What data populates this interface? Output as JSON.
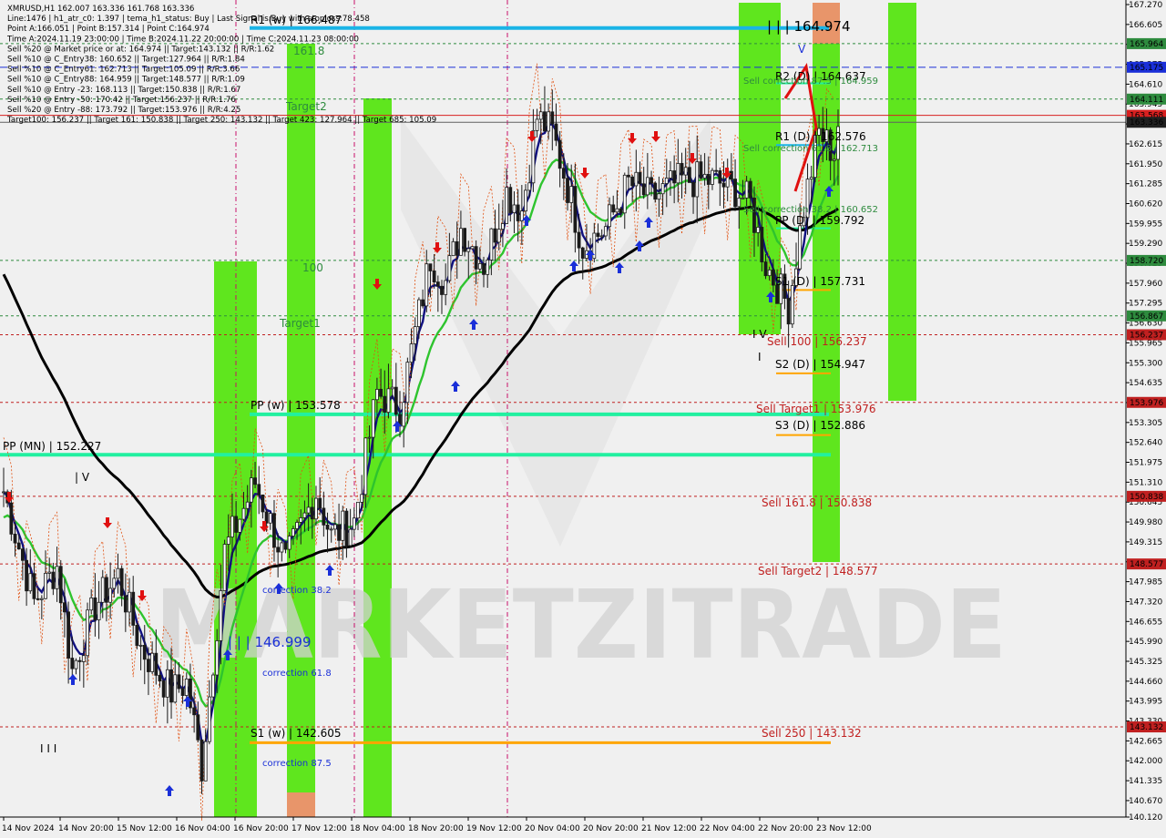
{
  "chart_data": {
    "type": "candlestick",
    "symbol": "XMRUSD",
    "timeframe": "H1",
    "ylim": [
      140.12,
      167.27
    ],
    "y_ticks": [
      "167.270",
      "166.605",
      "165.940",
      "165.275",
      "164.610",
      "163.945",
      "163.280",
      "162.615",
      "161.950",
      "161.285",
      "160.620",
      "159.955",
      "159.290",
      "158.625",
      "157.960",
      "157.295",
      "156.630",
      "155.965",
      "155.300",
      "154.635",
      "153.970",
      "153.305",
      "152.640",
      "151.975",
      "151.310",
      "150.645",
      "149.980",
      "149.315",
      "148.650",
      "147.985",
      "147.320",
      "146.655",
      "145.990",
      "145.325",
      "144.660",
      "143.995",
      "143.330",
      "142.665",
      "142.000",
      "141.335",
      "140.670",
      "140.120"
    ],
    "x_labels": [
      "14 Nov 2024",
      "14 Nov 20:00",
      "15 Nov 12:00",
      "16 Nov 04:00",
      "16 Nov 20:00",
      "17 Nov 12:00",
      "18 Nov 04:00",
      "18 Nov 20:00",
      "19 Nov 12:00",
      "20 Nov 04:00",
      "20 Nov 20:00",
      "21 Nov 12:00",
      "22 Nov 04:00",
      "22 Nov 20:00",
      "23 Nov 12:00"
    ],
    "info_lines": [
      "XMRUSD,H1  162.007 163.336 161.768 163.336",
      "Line:1476  |  h1_atr_c0: 1.397  |  tema_h1_status: Buy  |  Last Signal is:Buy with stoploss:78.458",
      "Point A:166.051  |  Point B:157.314  |  Point C:164.974",
      "Time A:2024.11.19 23:00:00  |  Time B:2024.11.22 20:00:00  |  Time C:2024.11.23 08:00:00",
      "Sell %20 @ Market price or at: 164.974  ||  Target:143.132  ||  R/R:1.62",
      "Sell %10 @ C_Entry38: 160.652  ||  Target:127.964  ||  R/R:1.84",
      "Sell %10 @ C_Entry61: 162.713  ||  Target:105.09  ||  R/R:3.66",
      "Sell %10 @ C_Entry88: 164.959  ||  Target:148.577  ||  R/R:1.09",
      "Sell %10 @ Entry -23: 168.113  ||  Target:150.838  ||  R/R:1.67",
      "Sell %10 @ Entry -50: 170.42  ||  Target:156.237  ||  R/R:1.76",
      "Sell %20 @ Entry -88: 173.792  ||  Target:153.976  ||  R/R:4.25",
      "Target100: 156.237  ||  Target 161: 150.838  ||  Target 250: 143.132  ||  Target 423: 127.964  ||  Target 685: 105.09"
    ],
    "price_tags": [
      {
        "text": "165.964",
        "color": "#2e8b3e"
      },
      {
        "text": "165.175",
        "color": "#1a2fd8"
      },
      {
        "text": "164.111",
        "color": "#2e8b3e"
      },
      {
        "text": "163.568",
        "color": "#d82020"
      },
      {
        "text": "163.336",
        "color": "#202020"
      },
      {
        "text": "158.720",
        "color": "#2e8b3e"
      },
      {
        "text": "156.867",
        "color": "#2e8b3e"
      },
      {
        "text": "156.237",
        "color": "#c02020"
      },
      {
        "text": "153.976",
        "color": "#c02020"
      },
      {
        "text": "150.838",
        "color": "#c02020"
      },
      {
        "text": "148.577",
        "color": "#c02020"
      },
      {
        "text": "143.132",
        "color": "#c02020"
      }
    ],
    "level_labels": [
      {
        "text": "R1 (w) | 166.487",
        "color": "#000000"
      },
      {
        "text": "| | | 164.974",
        "color": "#000000"
      },
      {
        "text": "R2 (D) | 164.637",
        "color": "#000000"
      },
      {
        "text": "Sell correction 87.5 | 164.959",
        "color": "#2e8b3e"
      },
      {
        "text": "R1 (D) | 162.576",
        "color": "#000000"
      },
      {
        "text": "Sell correction 61.8 | 162.713",
        "color": "#2e8b3e"
      },
      {
        "text": "Sell correction 38.2 | 160.652",
        "color": "#2e8b3e"
      },
      {
        "text": "PP (D) | 159.792",
        "color": "#000000"
      },
      {
        "text": "S1 (D) | 157.731",
        "color": "#000000"
      },
      {
        "text": "Sell 100 | 156.237",
        "color": "#c02020"
      },
      {
        "text": "S2 (D) | 154.947",
        "color": "#000000"
      },
      {
        "text": "Sell Target1 | 153.976",
        "color": "#c02020"
      },
      {
        "text": "S3 (D) | 152.886",
        "color": "#000000"
      },
      {
        "text": "PP (w) | 153.578",
        "color": "#000000"
      },
      {
        "text": "PP (MN) | 152.227",
        "color": "#000000"
      },
      {
        "text": "Sell 161.8 | 150.838",
        "color": "#c02020"
      },
      {
        "text": "Sell Target2 | 148.577",
        "color": "#c02020"
      },
      {
        "text": "| | | 146.999",
        "color": "#1a2fd8"
      },
      {
        "text": "S1 (w) | 142.605",
        "color": "#000000"
      },
      {
        "text": "Sell 250 | 143.132",
        "color": "#c02020"
      },
      {
        "text": "161.8",
        "color": "#2e8b3e"
      },
      {
        "text": "Target2",
        "color": "#2e8b3e"
      },
      {
        "text": "100",
        "color": "#2e8b3e"
      },
      {
        "text": "Target1",
        "color": "#2e8b3e"
      },
      {
        "text": "correction 38.2",
        "color": "#1a2fd8"
      },
      {
        "text": "correction 61.8",
        "color": "#1a2fd8"
      },
      {
        "text": "correction 87.5",
        "color": "#1a2fd8"
      },
      {
        "text": "| V",
        "color": "#000000"
      },
      {
        "text": "I V",
        "color": "#000000"
      },
      {
        "text": "I I I",
        "color": "#000000"
      },
      {
        "text": "V",
        "color": "#1a2fd8"
      },
      {
        "text": "I",
        "color": "#000000"
      }
    ],
    "watermark": "MARKETZITRADE",
    "colors": {
      "background": "#f0f0f0",
      "zone_green": "#5fe61e",
      "zone_orange": "#e8956a",
      "ema_slow": "#000000",
      "ema_mid": "#2ec42e",
      "tema": "#101080",
      "candles": "#1a1a1a",
      "buy_arrow": "#1a2fd8",
      "sell_arrow": "#e01010",
      "pivot_cyan": "#1ab4e6",
      "pivot_spring": "#22f0a0",
      "support_orange": "#ffa500"
    }
  }
}
